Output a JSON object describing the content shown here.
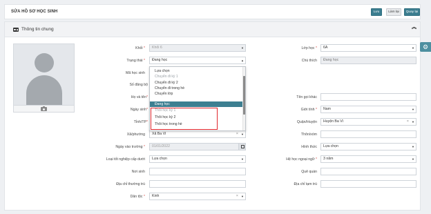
{
  "header": {
    "title": "SỬA HỒ SƠ HỌC SINH",
    "buttons": {
      "save": "Lưu",
      "reset": "Làm lại",
      "back": "Quay lại"
    }
  },
  "panel": {
    "title": "Thông tin chung"
  },
  "form": {
    "khoi": {
      "label": "Khối",
      "value": "Khối 6"
    },
    "trang_thai": {
      "label": "Trạng thái",
      "value": "Đang học"
    },
    "ma_hoc_sinh": {
      "label": "Mã học sinh"
    },
    "so_dang_bo": {
      "label": "Số đăng bộ"
    },
    "ho_va_ten": {
      "label": "Họ và tên"
    },
    "ngay_sinh": {
      "label": "Ngày sinh"
    },
    "tinh_tp": {
      "label": "Tỉnh/TP"
    },
    "xa_phuong": {
      "label": "Xã/phường",
      "value": "Xã Ba Vì"
    },
    "ngay_vao_truong": {
      "label": "Ngày vào trường",
      "value": "01/01/2022"
    },
    "loai_tot_nghiep": {
      "label": "Loại tốt nghiệp cấp dưới",
      "value": "Lựa chọn"
    },
    "noi_sinh": {
      "label": "Nơi sinh"
    },
    "dia_chi_thuong_tru": {
      "label": "Địa chỉ thường trú"
    },
    "dan_toc": {
      "label": "Dân tộc",
      "value": "Kinh"
    },
    "lop_hoc": {
      "label": "Lớp học",
      "value": "6A"
    },
    "chu_thich": {
      "label": "Chú thích",
      "value": "Đang học"
    },
    "ten_goi_khac": {
      "label": "Tên gọi khác"
    },
    "gioi_tinh": {
      "label": "Giới tính",
      "value": "Nam"
    },
    "quan_huyen": {
      "label": "Quận/Huyện",
      "value": "Huyện Ba Vì"
    },
    "thon_xom": {
      "label": "Thôn/xóm"
    },
    "hinh_thuc": {
      "label": "Hình thức",
      "value": "Lựa chọn"
    },
    "he_hoc_ngoai_ngu": {
      "label": "Hệ học ngoại ngữ",
      "value": "3 năm"
    },
    "que_quan": {
      "label": "Quê quán"
    },
    "dia_chi_tam_tru": {
      "label": "Địa chỉ tạm trú"
    },
    "required_mark": "*"
  },
  "dropdown": {
    "options": [
      {
        "label": "Lựa chọn",
        "state": "normal"
      },
      {
        "label": "Chuyển đi kỳ 1",
        "state": "muted"
      },
      {
        "label": "Chuyển đi kỳ 2",
        "state": "normal"
      },
      {
        "label": "Chuyển đi trong hè",
        "state": "normal"
      },
      {
        "label": "Chuyển lớp",
        "state": "normal"
      },
      {
        "label": "Đang học",
        "state": "selected"
      },
      {
        "label": "Thôi học kỳ 1",
        "state": "muted"
      },
      {
        "label": "Thôi học kỳ 2",
        "state": "normal"
      },
      {
        "label": "Thôi học trong hè",
        "state": "normal"
      }
    ]
  },
  "icons": {
    "card": "id-card-icon",
    "collapse": "chevron-up-icon",
    "gear": "gear-icon",
    "camera": "camera-icon",
    "calendar": "calendar-icon"
  },
  "colors": {
    "accent": "#3b7d8f",
    "highlight": "#e0242a",
    "required": "#d9534f"
  }
}
